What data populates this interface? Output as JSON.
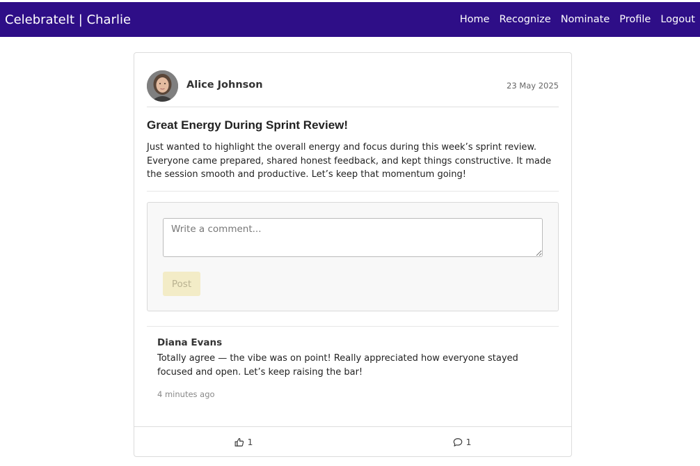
{
  "navbar": {
    "brand": "CelebrateIt | Charlie",
    "links": [
      "Home",
      "Recognize",
      "Nominate",
      "Profile",
      "Logout"
    ]
  },
  "post": {
    "author": "Alice Johnson",
    "date": "23 May 2025",
    "title": "Great Energy During Sprint Review!",
    "body": "Just wanted to highlight the overall energy and focus during this week’s sprint review. Everyone came prepared, shared honest feedback, and kept things constructive. It made the session smooth and productive. Let’s keep that momentum going!"
  },
  "comment_form": {
    "placeholder": "Write a comment...",
    "post_label": "Post"
  },
  "comments": [
    {
      "author": "Diana Evans",
      "text": "Totally agree — the vibe was on point! Really appreciated how everyone stayed focused and open. Let’s keep raising the bar!",
      "time": "4 minutes ago"
    }
  ],
  "footer": {
    "likes_count": "1",
    "comments_count": "1"
  },
  "colors": {
    "navbar": "#2e0e87",
    "post_button_bg": "#f3ecc7"
  },
  "icons": {
    "like": "thumbs-up-icon",
    "comment": "comment-bubble-icon"
  }
}
